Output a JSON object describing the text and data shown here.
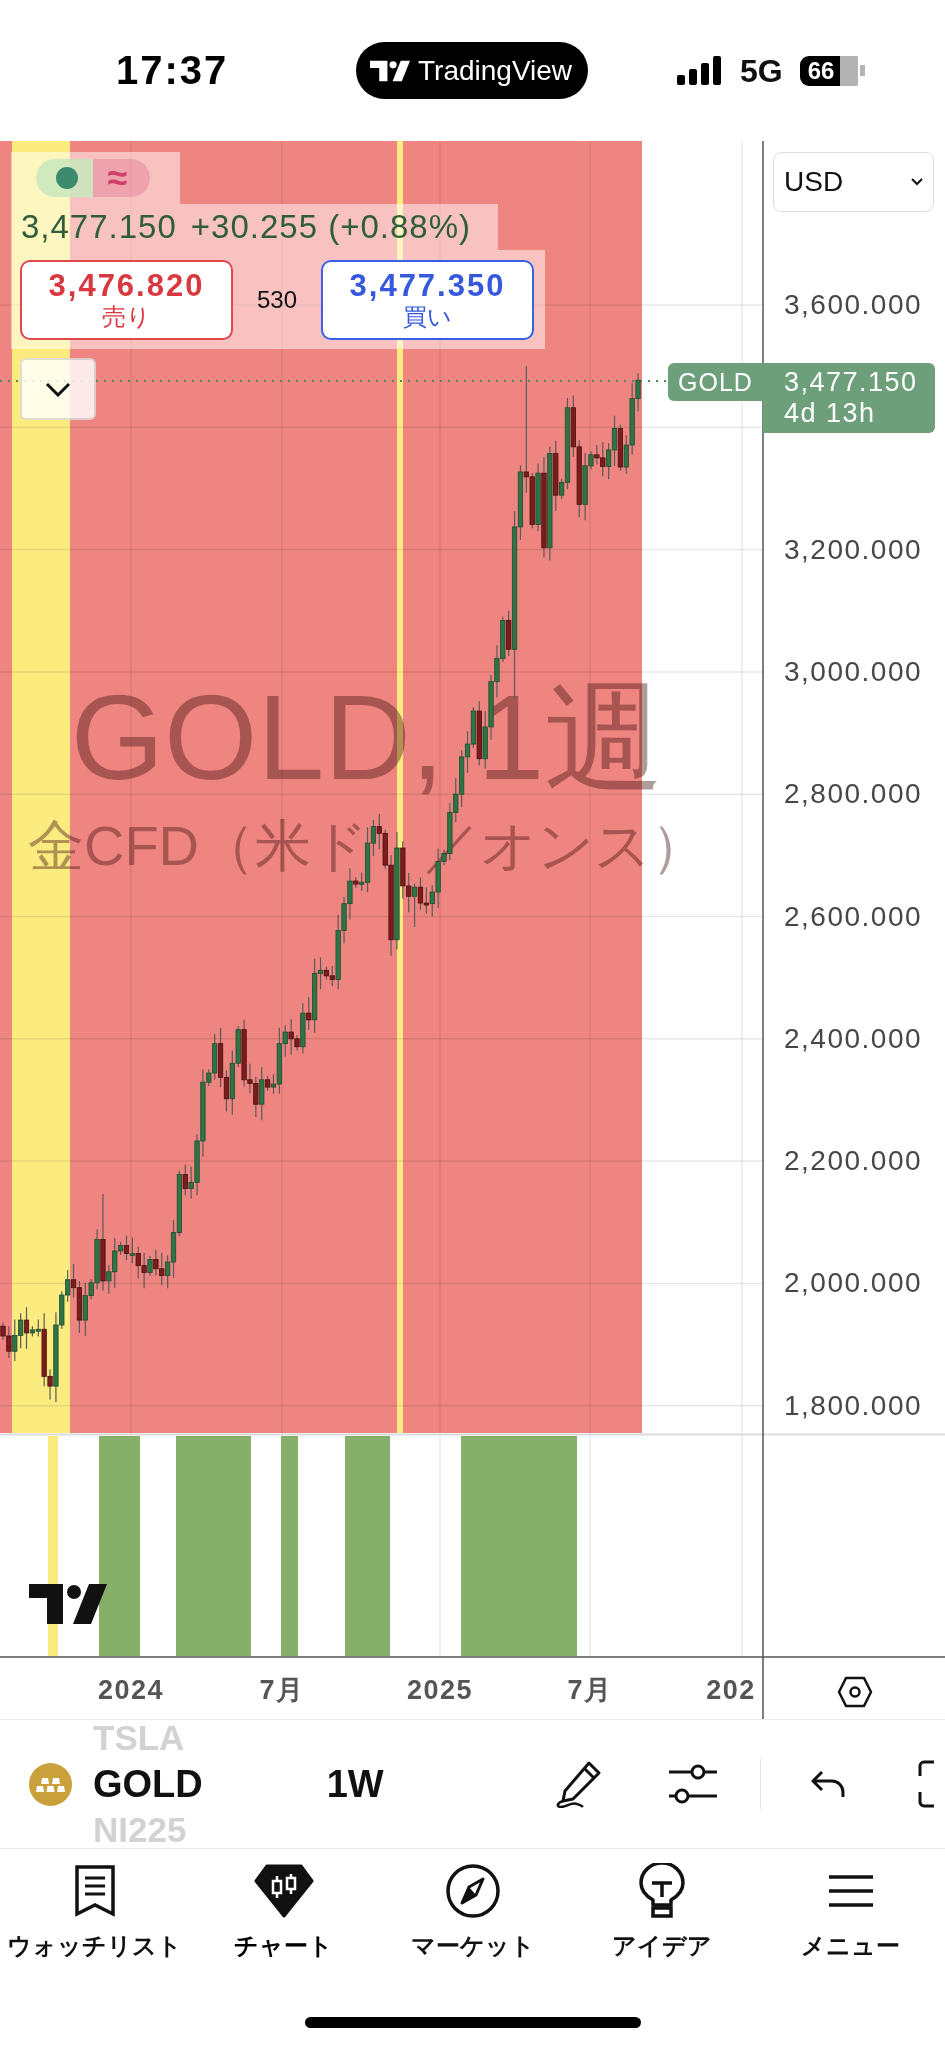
{
  "status_bar": {
    "time": "17:37",
    "app_name": "TradingView",
    "network": "5G",
    "battery": "66"
  },
  "chart": {
    "legend": {
      "indicator_symbol": "≈",
      "last_price": "3,477.150",
      "change": "+30.255 (+0.88%)"
    },
    "sell": {
      "price": "3,476.820",
      "label": "売り"
    },
    "spread": "530",
    "buy": {
      "price": "3,477.350",
      "label": "買い"
    },
    "currency": "USD",
    "watermark": {
      "title": "GOLD, 1週",
      "subtitle": [
        "金CFD（米ド",
        "／オンス）"
      ]
    },
    "price_tag": {
      "symbol": "GOLD",
      "price": "3,477.150",
      "countdown": "4d 13h"
    },
    "price_axis": [
      "3,600.000",
      "3,200.000",
      "3,000.000",
      "2,800.000",
      "2,600.000",
      "2,400.000",
      "2,200.000",
      "2,000.000",
      "1,800.000"
    ],
    "time_axis": [
      "2024",
      "7月",
      "2025",
      "7月",
      "202"
    ]
  },
  "toolbar": {
    "symbols": [
      {
        "label": "TSLA",
        "selected": false
      },
      {
        "label": "GOLD",
        "selected": true
      },
      {
        "label": "NI225",
        "selected": false
      }
    ],
    "interval": "1W"
  },
  "nav": [
    {
      "label": "ウォッチリスト",
      "selected": false
    },
    {
      "label": "チャート",
      "selected": true
    },
    {
      "label": "マーケット",
      "selected": false
    },
    {
      "label": "アイデア",
      "selected": false
    },
    {
      "label": "メニュー",
      "selected": false
    }
  ]
}
